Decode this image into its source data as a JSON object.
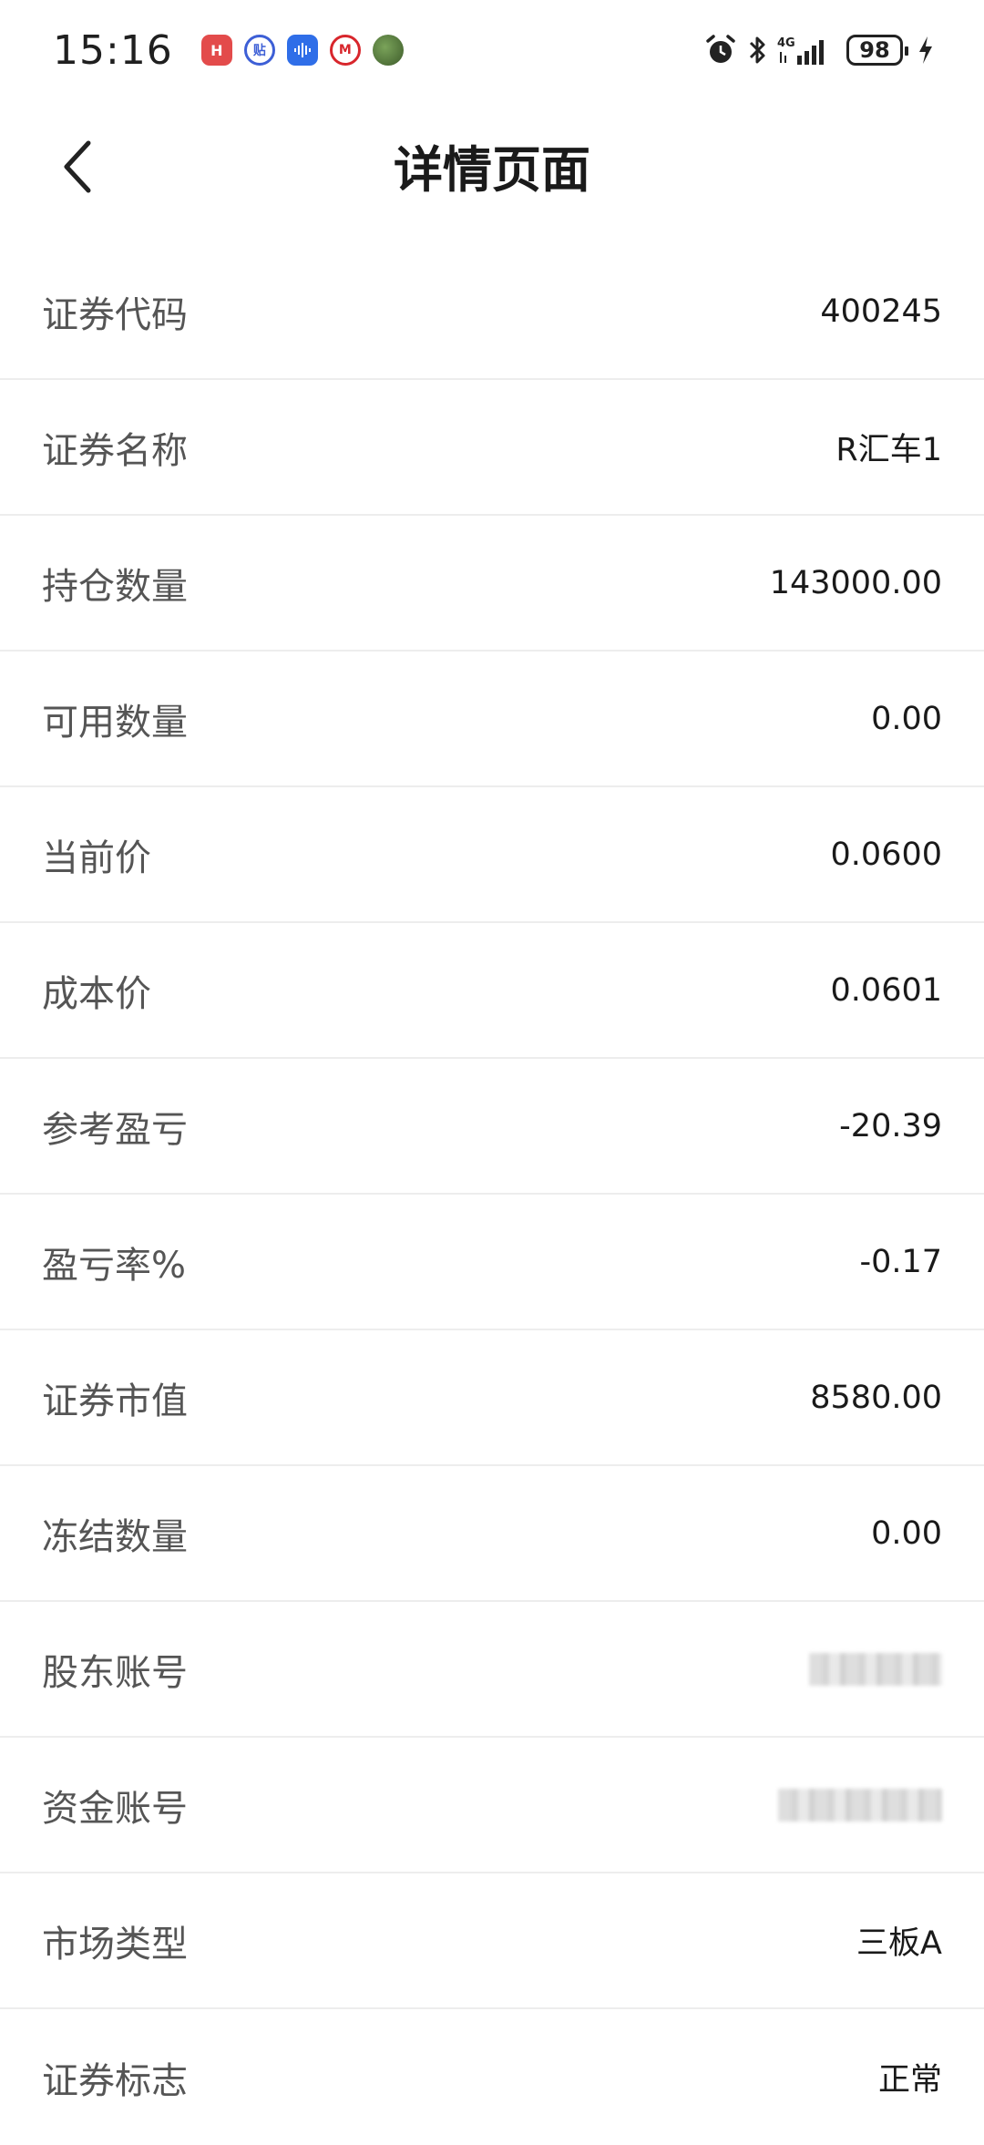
{
  "status_bar": {
    "time": "15:16",
    "app_icons": [
      "huawei-app-icon",
      "tieba-app-icon",
      "voice-app-icon",
      "cmb-app-icon",
      "game-app-icon"
    ],
    "network": "4G",
    "battery": "98"
  },
  "header": {
    "title": "详情页面",
    "back_icon": "chevron-left-icon"
  },
  "details": [
    {
      "label": "证券代码",
      "value": "400245"
    },
    {
      "label": "证券名称",
      "value": "R汇车1"
    },
    {
      "label": "持仓数量",
      "value": "143000.00"
    },
    {
      "label": "可用数量",
      "value": "0.00"
    },
    {
      "label": "当前价",
      "value": "0.0600"
    },
    {
      "label": "成本价",
      "value": "0.0601"
    },
    {
      "label": "参考盈亏",
      "value": "-20.39"
    },
    {
      "label": "盈亏率%",
      "value": "-0.17"
    },
    {
      "label": "证券市值",
      "value": "8580.00"
    },
    {
      "label": "冻结数量",
      "value": "0.00"
    },
    {
      "label": "股东账号",
      "value": ""
    },
    {
      "label": "资金账号",
      "value": ""
    },
    {
      "label": "市场类型",
      "value": "三板A"
    },
    {
      "label": "证券标志",
      "value": "正常"
    }
  ],
  "colors": {
    "background": "#ffffff",
    "label": "#555555",
    "value": "#1a1a1a",
    "divider": "#ededed"
  }
}
